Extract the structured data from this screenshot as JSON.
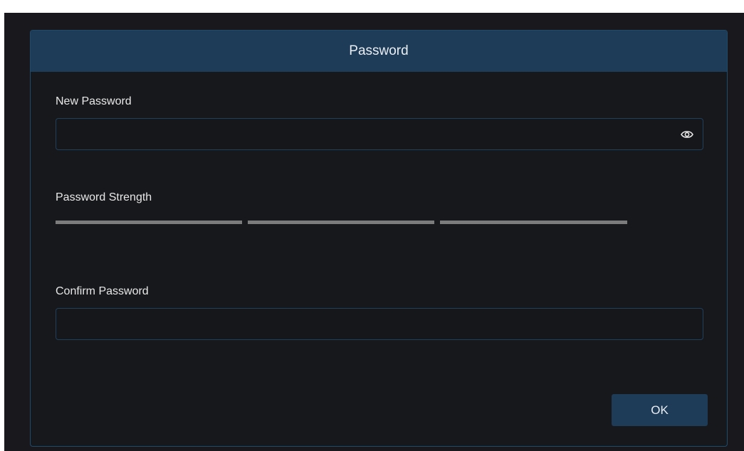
{
  "dialog": {
    "title": "Password",
    "new_password": {
      "label": "New Password",
      "value": "",
      "placeholder": "",
      "toggle_icon": "eye-icon"
    },
    "strength": {
      "label": "Password Strength",
      "segments": 3,
      "filled_segments": 0,
      "empty_color": "#7c7c7c"
    },
    "confirm_password": {
      "label": "Confirm Password",
      "value": "",
      "placeholder": ""
    },
    "ok_label": "OK"
  },
  "colors": {
    "header_bg": "#1e3b57",
    "dialog_bg": "#17181b",
    "border": "#1f4a6c",
    "button_bg": "#1e3b57"
  }
}
